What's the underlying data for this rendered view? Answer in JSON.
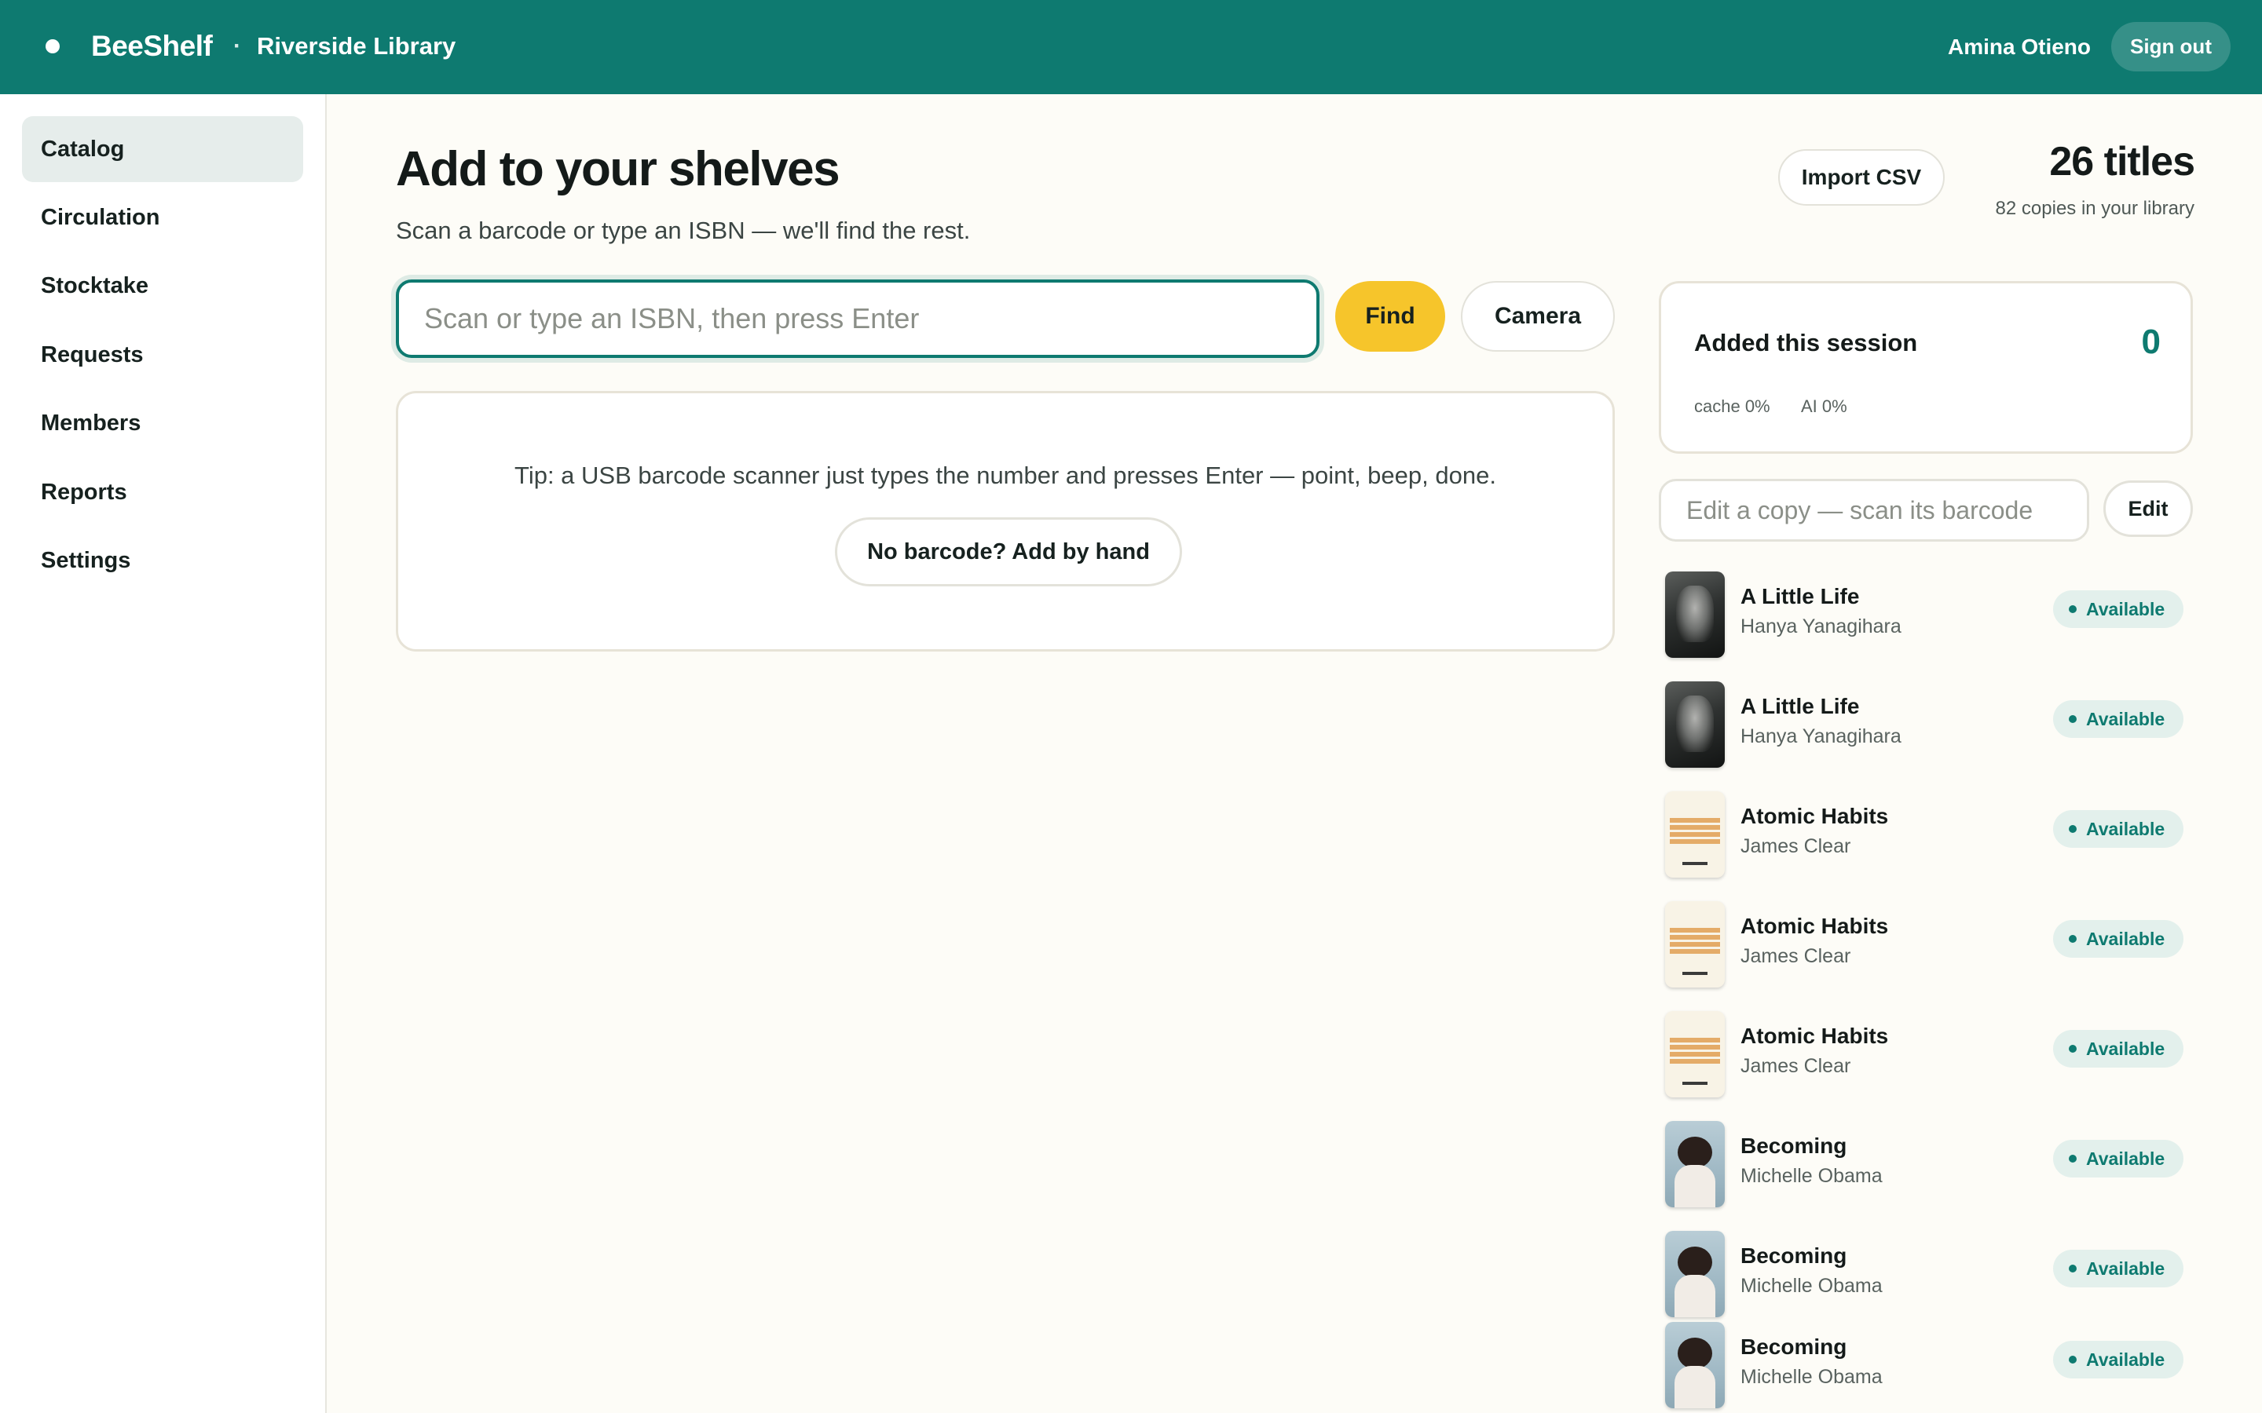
{
  "header": {
    "brand": "BeeShelf",
    "separator": "·",
    "library": "Riverside Library",
    "user": "Amina Otieno",
    "sign_out_label": "Sign out"
  },
  "sidebar": {
    "items": [
      {
        "label": "Catalog",
        "active": true
      },
      {
        "label": "Circulation"
      },
      {
        "label": "Stocktake"
      },
      {
        "label": "Requests"
      },
      {
        "label": "Members"
      },
      {
        "label": "Reports"
      },
      {
        "label": "Settings"
      }
    ]
  },
  "main": {
    "title": "Add to your shelves",
    "subtitle": "Scan a barcode or type an ISBN — we'll find the rest.",
    "import_label": "Import CSV",
    "titles_count": "26 titles",
    "copies_count": "82 copies in your library",
    "search": {
      "placeholder": "Scan or type an ISBN, then press Enter",
      "value": "",
      "find_label": "Find",
      "camera_label": "Camera"
    },
    "tip": {
      "text": "Tip: a USB barcode scanner just types the number and presses Enter — point, beep, done.",
      "button_label": "No barcode? Add by hand"
    }
  },
  "session": {
    "label": "Added this session",
    "count": "0",
    "cache": "cache 0%",
    "ai": "AI 0%"
  },
  "edit": {
    "placeholder": "Edit a copy — scan its barcode",
    "button_label": "Edit"
  },
  "books": [
    {
      "title": "A Little Life",
      "author": "Hanya Yanagihara",
      "status": "Available",
      "cover": "dark-portrait-cover"
    },
    {
      "title": "A Little Life",
      "author": "Hanya Yanagihara",
      "status": "Available",
      "cover": "dark-portrait-cover"
    },
    {
      "title": "Atomic Habits",
      "author": "James Clear",
      "status": "Available",
      "cover": "cream-text-cover"
    },
    {
      "title": "Atomic Habits",
      "author": "James Clear",
      "status": "Available",
      "cover": "cream-text-cover"
    },
    {
      "title": "Atomic Habits",
      "author": "James Clear",
      "status": "Available",
      "cover": "cream-text-cover"
    },
    {
      "title": "Becoming",
      "author": "Michelle Obama",
      "status": "Available",
      "cover": "blue-portrait-cover"
    },
    {
      "title": "Becoming",
      "author": "Michelle Obama",
      "status": "Available",
      "cover": "blue-portrait-cover"
    },
    {
      "title": "Becoming",
      "author": "Michelle Obama",
      "status": "Available",
      "cover": "blue-portrait-cover"
    }
  ],
  "colors": {
    "brand": "#0E7A70",
    "accent": "#F6C52B",
    "background": "#FDFCF7",
    "status_available": "#0E7A70"
  }
}
